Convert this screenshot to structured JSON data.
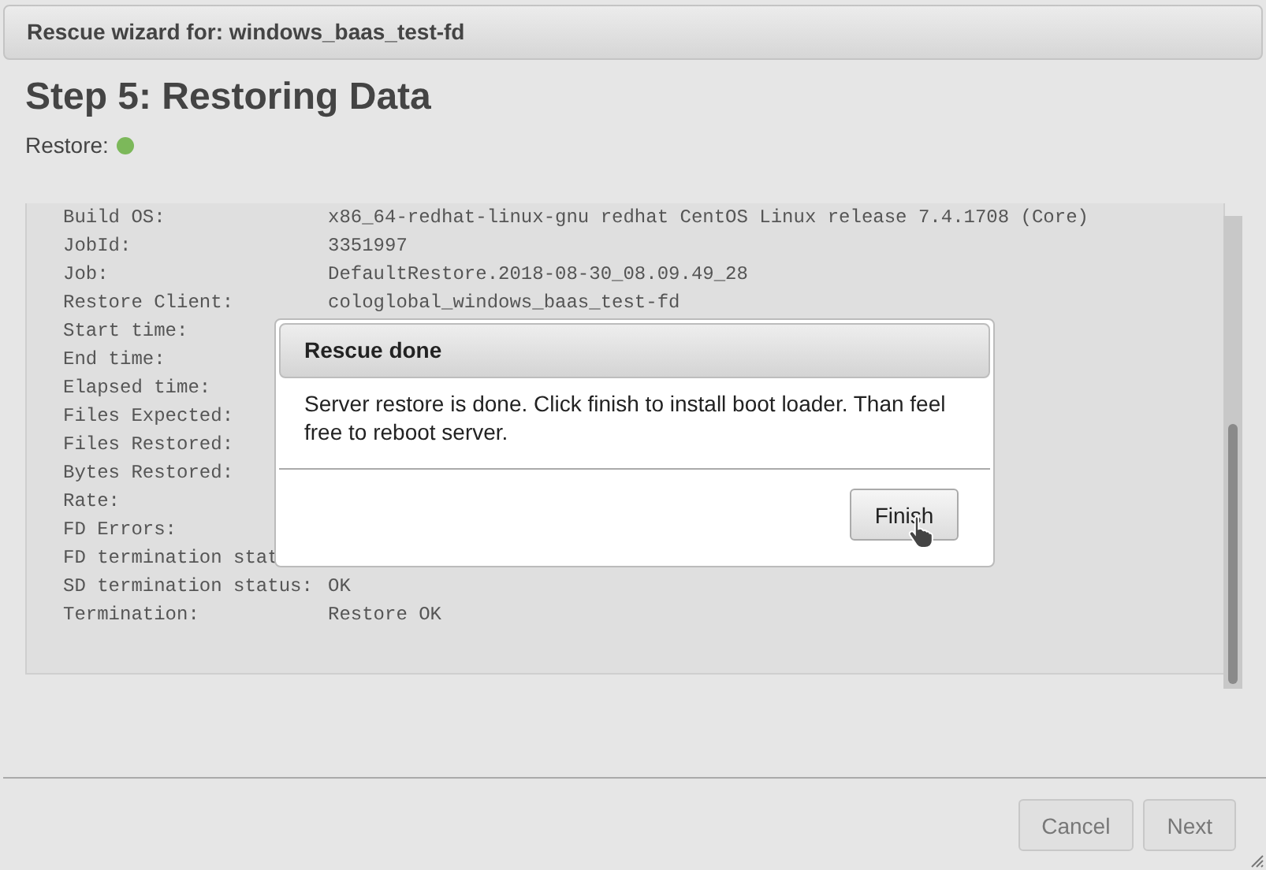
{
  "window": {
    "title": "Rescue wizard for: windows_baas_test-fd"
  },
  "step_title": "Step 5: Restoring Data",
  "status": {
    "label": "Restore:",
    "color": "#7cb85a"
  },
  "log": [
    {
      "label": "Build OS:",
      "value": "x86_64-redhat-linux-gnu redhat CentOS Linux release 7.4.1708 (Core)"
    },
    {
      "label": "JobId:",
      "value": "3351997"
    },
    {
      "label": "Job:",
      "value": "DefaultRestore.2018-08-30_08.09.49_28"
    },
    {
      "label": "Restore Client:",
      "value": "cologlobal_windows_baas_test-fd"
    },
    {
      "label": "Start time:"
    },
    {
      "label": "End time:"
    },
    {
      "label": "Elapsed time:"
    },
    {
      "label": "Files Expected:"
    },
    {
      "label": "Files Restored:"
    },
    {
      "label": "Bytes Restored:"
    },
    {
      "label": "Rate:"
    },
    {
      "label": "FD Errors:"
    },
    {
      "label": "FD termination stat"
    },
    {
      "label": "SD termination status:",
      "value": "OK"
    },
    {
      "label": "Termination:",
      "value": "Restore OK"
    }
  ],
  "dialog": {
    "title": "Rescue done",
    "message": "Server restore is done. Click finish to install boot loader. Than feel free to reboot server.",
    "button": "Finish"
  },
  "buttons": [
    {
      "label": "Cancel"
    },
    {
      "label": "Next"
    }
  ]
}
